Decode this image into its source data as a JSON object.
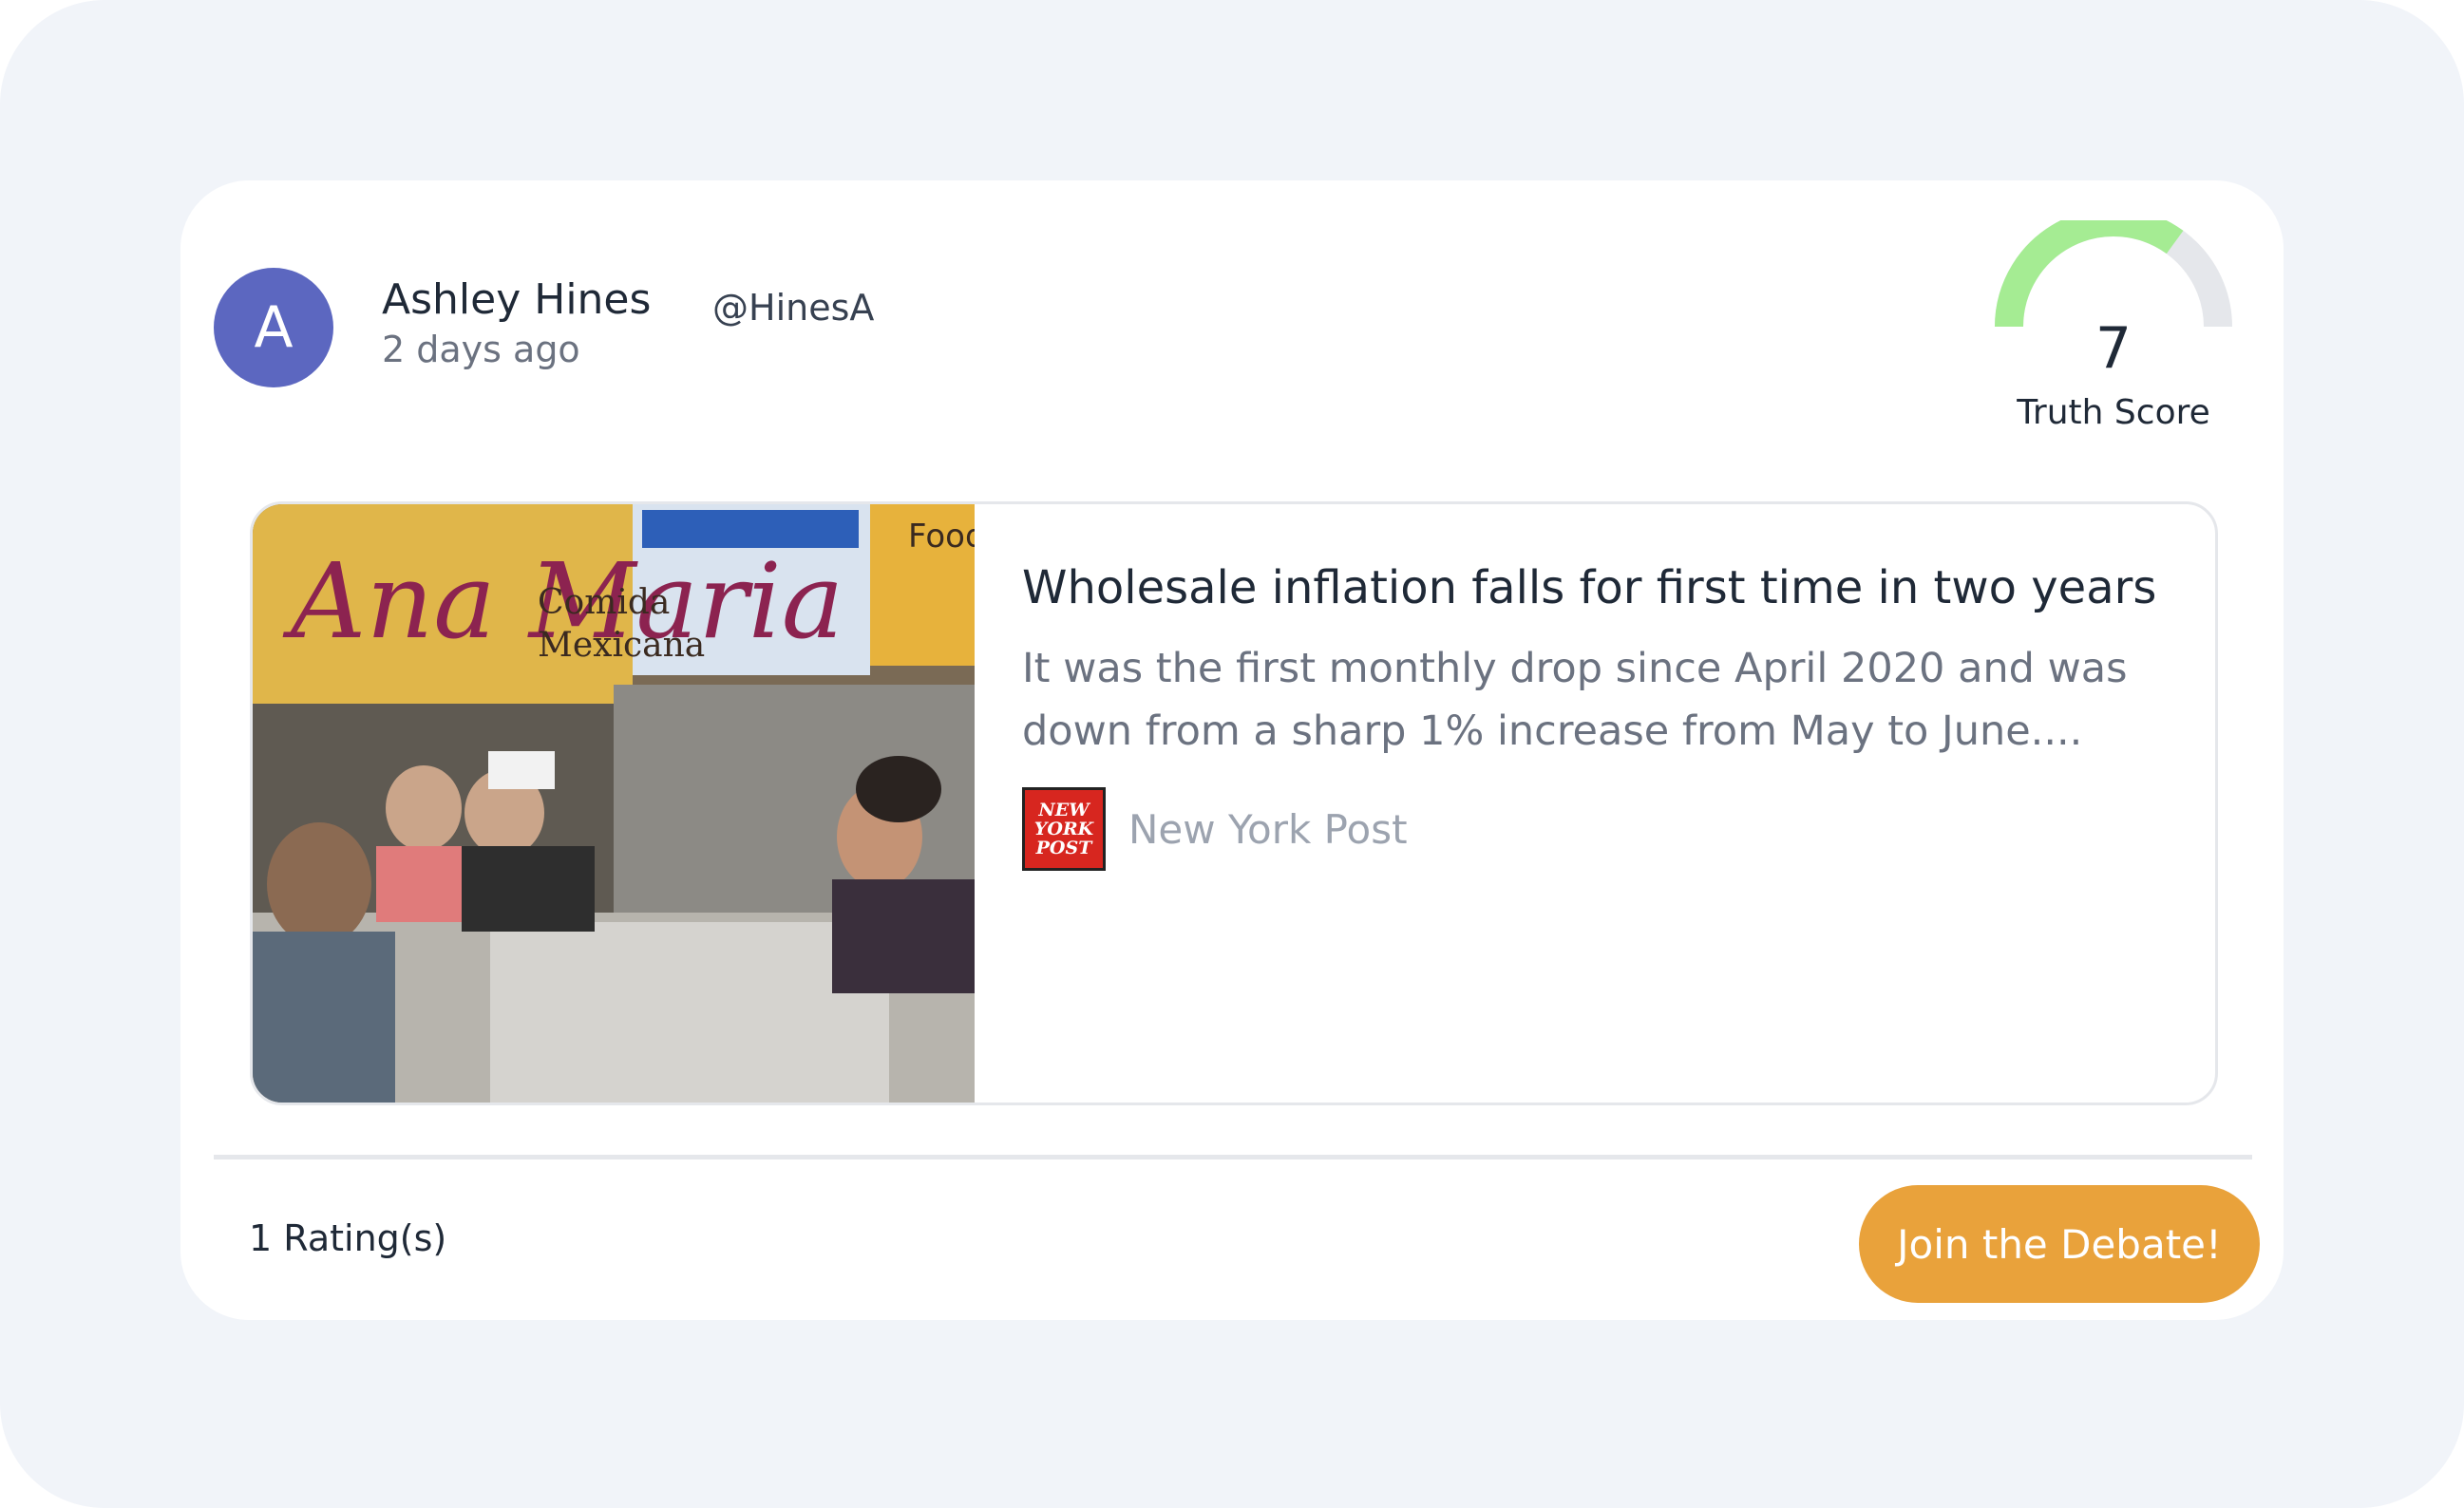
{
  "post": {
    "author": {
      "initial": "A",
      "name": "Ashley Hines",
      "handle": "@HinesA",
      "time": "2 days ago",
      "avatar_color": "#5c67c0"
    },
    "truth_score": {
      "value": "7",
      "label": "Truth Score",
      "fill_fraction": 0.7,
      "fill_color": "#a5ec93",
      "track_color": "#e5e7eb"
    },
    "article": {
      "title": "Wholesale inflation falls for first time in two years",
      "summary": "It was the first monthly drop since April 2020 and was down from a sharp 1% increase from May to June....",
      "source": {
        "name": "New York Post",
        "logo_lines": [
          "NEW",
          "YORK",
          "POST"
        ],
        "logo_color": "#d7261f"
      },
      "image": {
        "description_icon": "photo-icon",
        "sign_text_1": "Ana Maria",
        "sign_text_2": "Comida",
        "sign_text_3": "Mexicana",
        "sign_text_4": "Food"
      }
    },
    "footer": {
      "ratings": "1 Rating(s)",
      "cta_label": "Join the Debate!",
      "cta_color": "#e9a23b"
    }
  }
}
